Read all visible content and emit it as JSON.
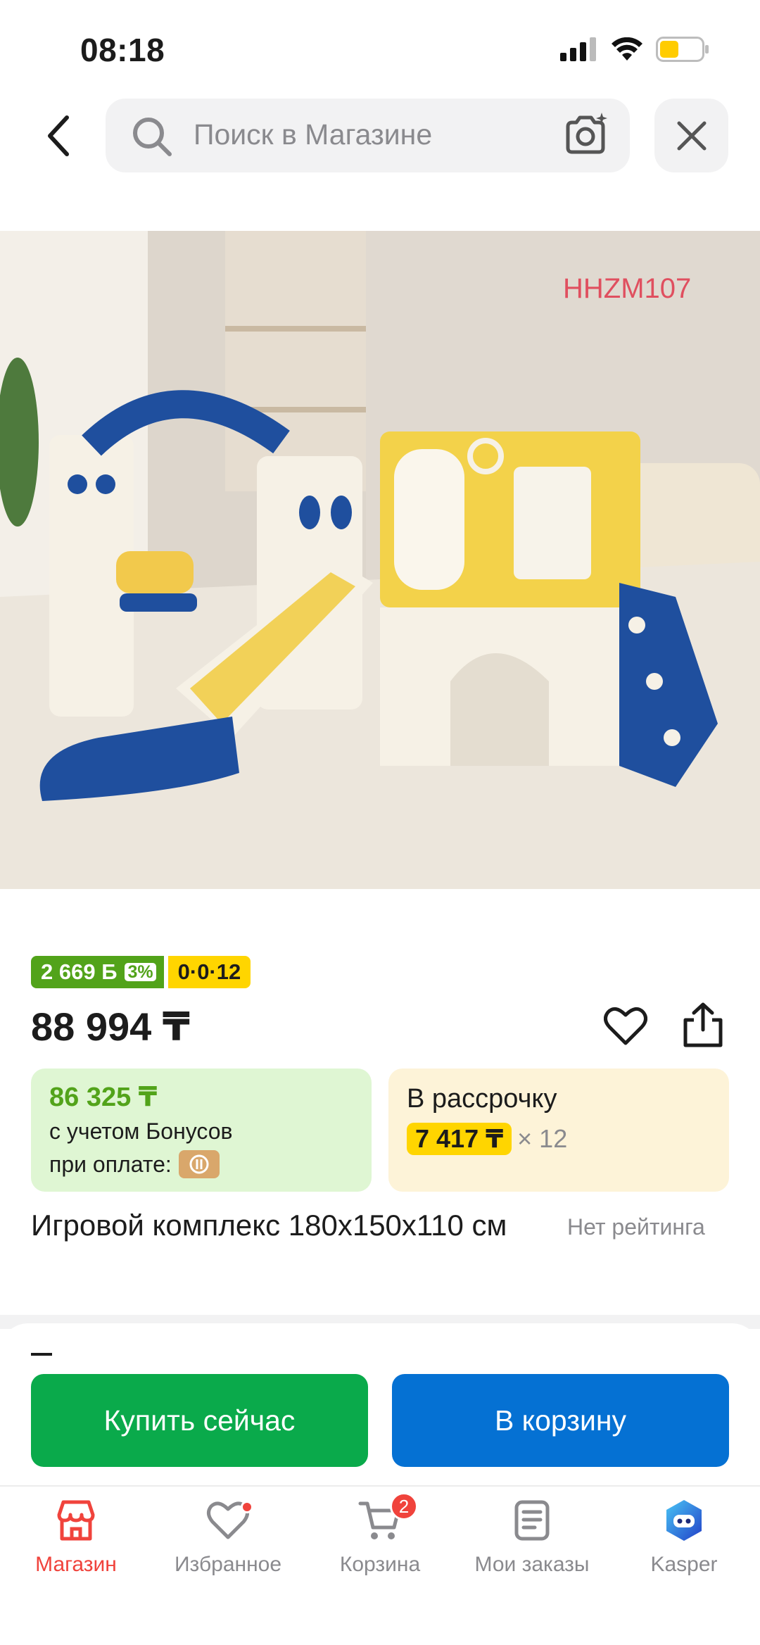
{
  "status_bar": {
    "time": "08:18"
  },
  "header": {
    "search_placeholder": "Поиск в Магазине",
    "icons": [
      "back-arrow-icon",
      "search-icon",
      "camera-icon",
      "close-icon"
    ]
  },
  "product_image": {
    "watermark": "HHZM107"
  },
  "product": {
    "bonus_badge": "2 669 Б",
    "bonus_percent": "3%",
    "installment_badge": "0·0·12",
    "price": "88 994 ₸",
    "bonus_price": "86 325 ₸",
    "bonus_line1": "с учетом Бонусов",
    "bonus_line2": "при оплате:",
    "installment_label": "В рассрочку",
    "installment_amount": "7 417 ₸",
    "installment_multiplier": "× 12",
    "title": "Игровой комплекс 180x150x110 см",
    "rating": "Нет рейтинга"
  },
  "actions": {
    "buy_now": "Купить сейчас",
    "add_to_cart": "В корзину"
  },
  "tabs": [
    {
      "label": "Магазин",
      "icon": "store-icon",
      "active": true
    },
    {
      "label": "Избранное",
      "icon": "heart-icon"
    },
    {
      "label": "Корзина",
      "icon": "cart-icon",
      "badge": "2"
    },
    {
      "label": "Мои заказы",
      "icon": "orders-icon"
    },
    {
      "label": "Kasper",
      "icon": "kasper-icon"
    }
  ],
  "colors": {
    "accent_red": "#f0433c",
    "bonus_green": "#52a31a",
    "buy_green": "#0aaa4b",
    "cart_blue": "#0571d3",
    "installment_yellow": "#ffd500"
  }
}
